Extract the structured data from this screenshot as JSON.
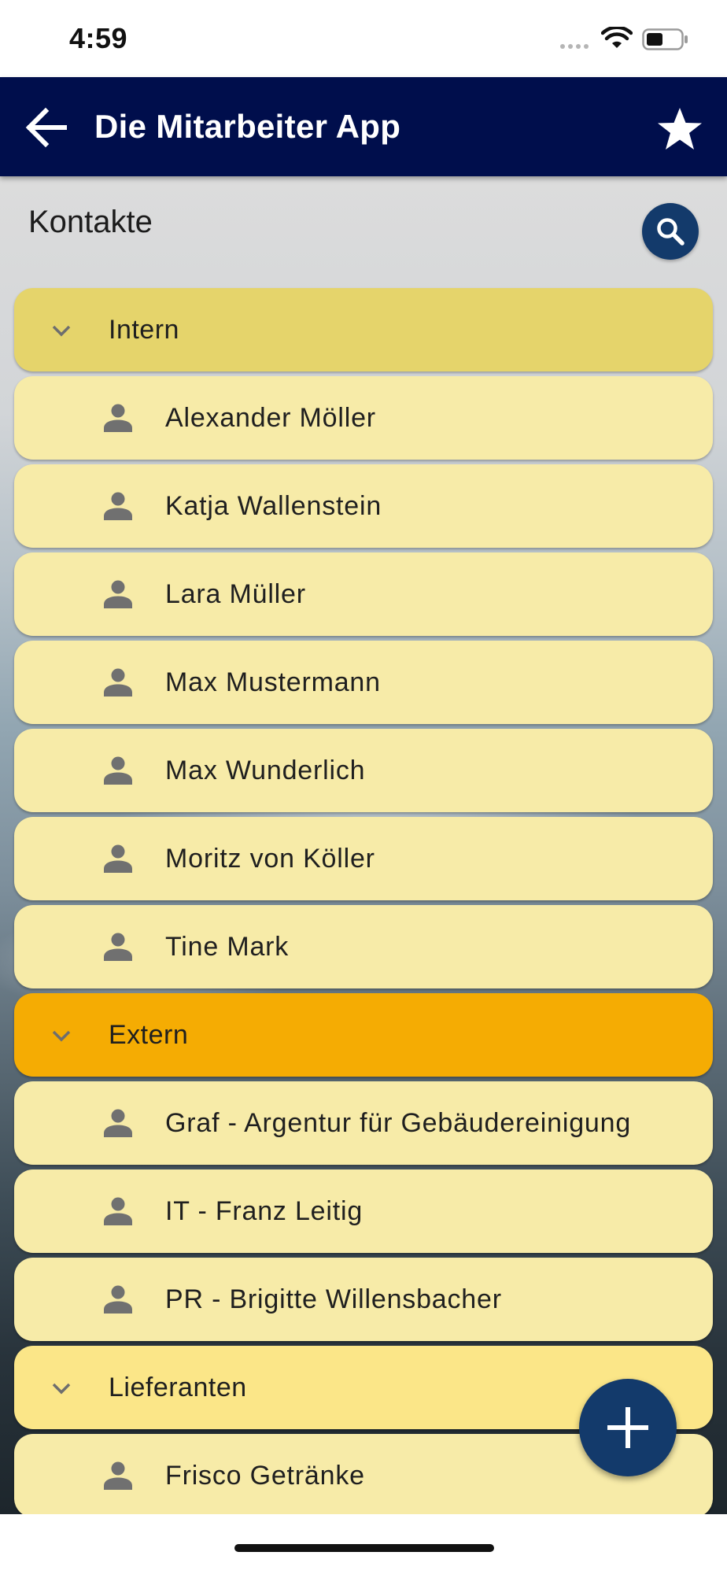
{
  "status_bar": {
    "time": "4:59"
  },
  "header": {
    "title": "Die Mitarbeiter App",
    "back_icon": "arrow-left-icon",
    "favorite_icon": "star-icon",
    "background_color": "#000e4c"
  },
  "section": {
    "title": "Kontakte",
    "search_icon": "search-icon"
  },
  "groups": [
    {
      "label": "Intern",
      "color": "#e5d46b",
      "expanded": true,
      "contacts": [
        "Alexander Möller",
        "Katja Wallenstein",
        "Lara Müller",
        "Max Mustermann",
        "Max Wunderlich",
        "Moritz von Köller",
        "Tine Mark"
      ]
    },
    {
      "label": "Extern",
      "color": "#f5ac03",
      "expanded": true,
      "contacts": [
        "Graf - Argentur für Gebäudereinigung",
        "IT - Franz Leitig",
        "PR - Brigitte Willensbacher"
      ]
    },
    {
      "label": "Lieferanten",
      "color": "#fbe688",
      "expanded": true,
      "contacts": [
        "Frisco Getränke"
      ]
    }
  ],
  "contact_row_color": "#f7eba8",
  "accent_color": "#133a6b",
  "fab": {
    "icon": "plus-icon"
  }
}
